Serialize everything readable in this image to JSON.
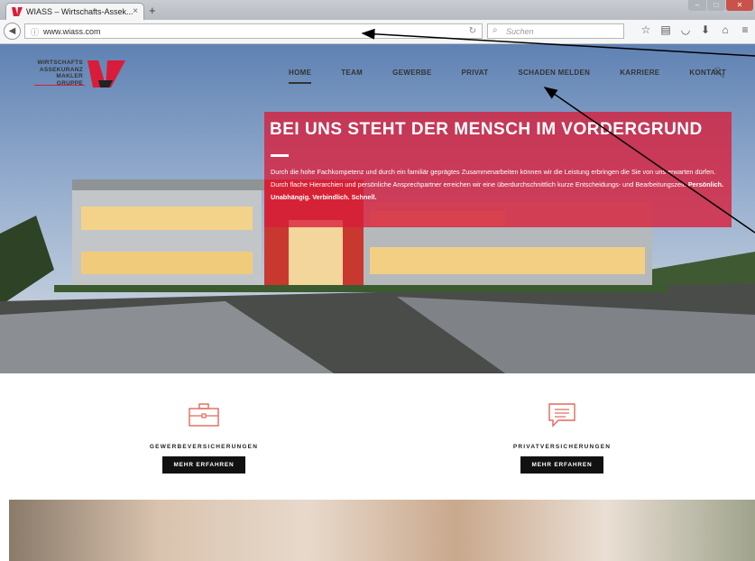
{
  "browser": {
    "tab_title": "WIASS – Wirtschafts-Assek...",
    "tab_close": "×",
    "new_tab": "+",
    "url": "www.wiass.com",
    "search_placeholder": "Suchen"
  },
  "site": {
    "logo_lines": [
      "WIRTSCHAFTS",
      "ASSEKURANZ",
      "MAKLER",
      "GRUPPE"
    ],
    "menu": [
      "HOME",
      "TEAM",
      "GEWERBE",
      "PRIVAT",
      "SCHADEN MELDEN",
      "KARRIERE",
      "KONTAKT"
    ],
    "hero": {
      "headline": "BEI UNS STEHT DER MENSCH IM VORDERGRUND",
      "text": "Durch die hohe Fachkompetenz und durch ein familiär geprägtes Zusammenarbeiten können wir die Leistung erbringen die Sie von uns erwarten dürfen. Durch flache Hierarchien und persönliche Ansprechpartner erreichen wir eine überdurchschnittlich kurze Entscheidungs- und Bearbeitungszeit.",
      "emphasis": "Persönlich. Unabhängig. Verbindlich. Schnell."
    },
    "cards": [
      {
        "label": "GEWERBEVERSICHERUNGEN",
        "button": "MEHR ERFAHREN"
      },
      {
        "label": "PRIVATVERSICHERUNGEN",
        "button": "MEHR ERFAHREN"
      }
    ]
  },
  "colors": {
    "accent": "#d91c3a",
    "button": "#111111"
  }
}
